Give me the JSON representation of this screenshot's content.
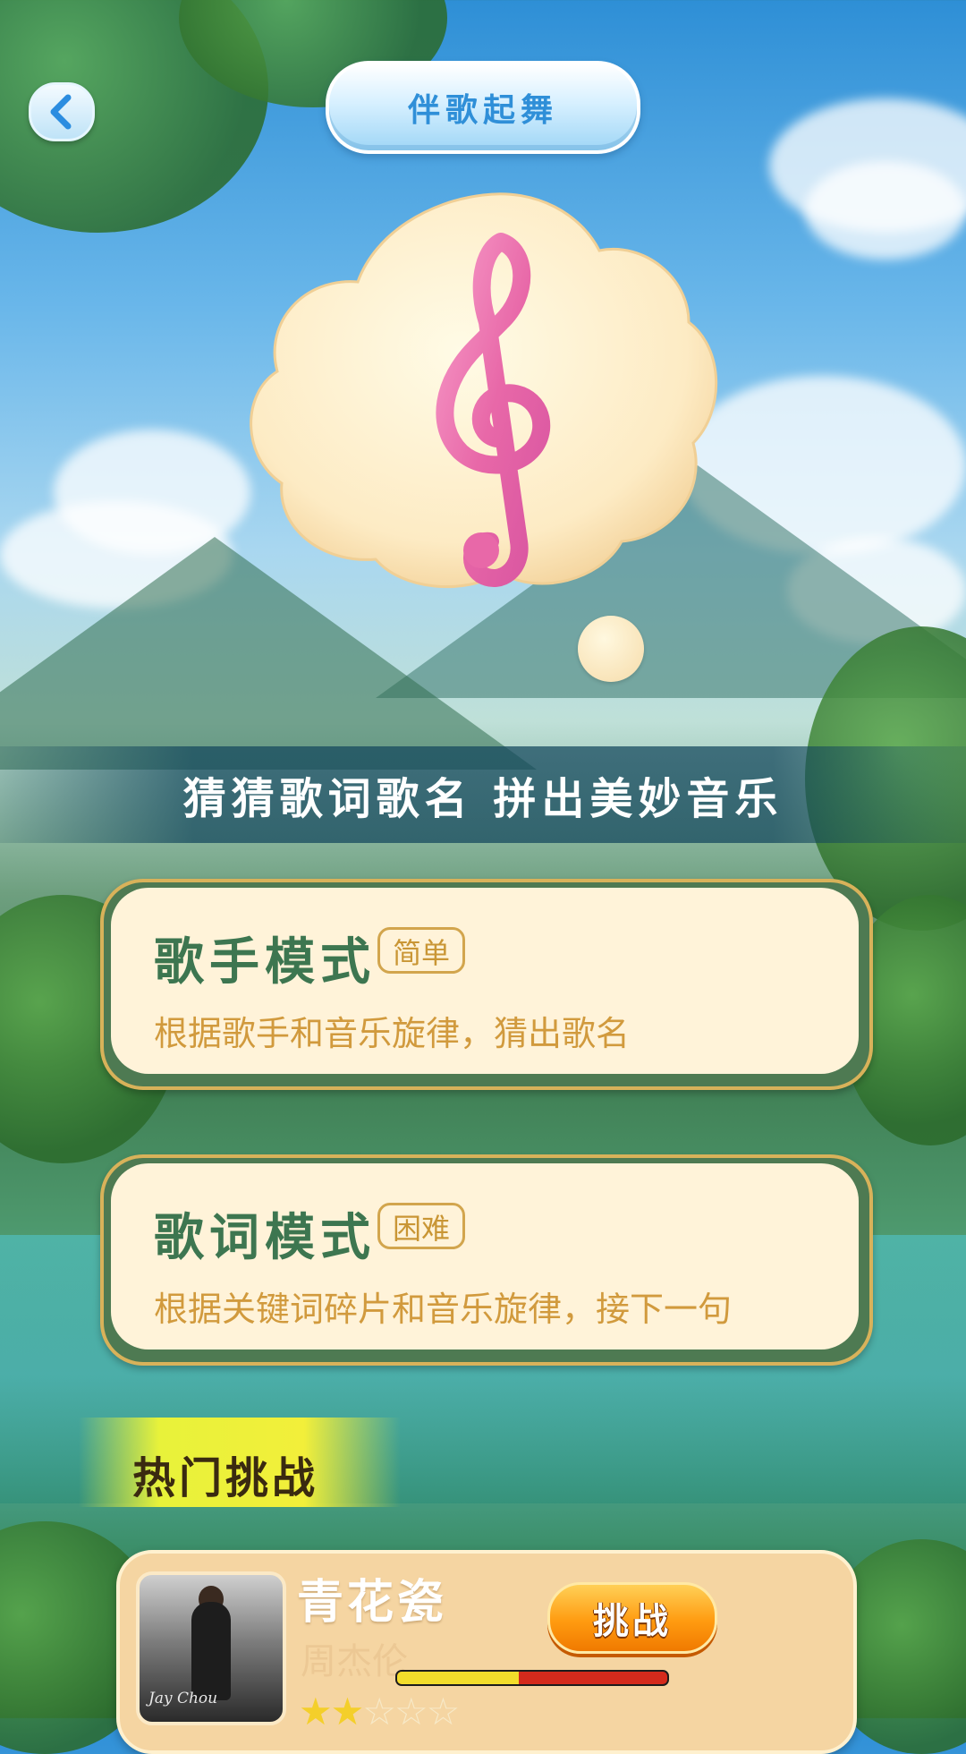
{
  "header": {
    "back_icon": "chevron-left-icon",
    "title": "伴歌起舞"
  },
  "hero": {
    "icon": "treble-clef-icon"
  },
  "slogan": "猜猜歌词歌名  拼出美妙音乐",
  "modes": [
    {
      "title": "歌手模式",
      "badge": "简单",
      "description": "根据歌手和音乐旋律，猜出歌名"
    },
    {
      "title": "歌词模式",
      "badge": "困难",
      "description": "根据关键词碎片和音乐旋律，接下一句"
    }
  ],
  "hot_challenge": {
    "label": "热门挑战",
    "song": {
      "title": "青花瓷",
      "artist": "周杰伦",
      "album_text": "Jay Chou",
      "rating": 2,
      "rating_max": 5,
      "progress": 0.45,
      "button_label": "挑战"
    }
  },
  "colors": {
    "title_blue": "#2f8fd8",
    "mode_green": "#3d7650",
    "desc_gold": "#d19a3d",
    "button_orange": "#ff9b10",
    "star_yellow": "#f4cf2a"
  }
}
